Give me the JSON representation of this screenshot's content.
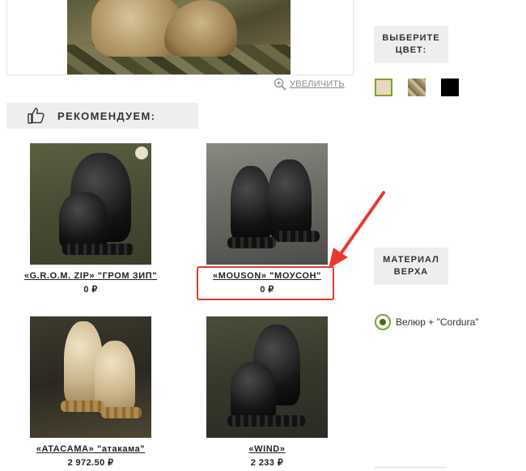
{
  "zoom": {
    "label": "УВЕЛИЧИТЬ",
    "icon": "zoom-in-icon"
  },
  "recommended": {
    "title": "РЕКОМЕНДУЕМ:",
    "icon": "thumbs-up-icon"
  },
  "products": [
    {
      "name": "«G.R.O.M. ZIP» \"ГРОМ ЗИП\"",
      "price": "0 ₽"
    },
    {
      "name": "«MOUSON» \"МОУСОН\"",
      "price": "0 ₽"
    },
    {
      "name": "«ATACAMA» \"атакама\"",
      "price": "2 972.50 ₽"
    },
    {
      "name": "«WIND»",
      "price": "2 233 ₽"
    }
  ],
  "color_picker": {
    "title": "ВЫБЕРИТЕ ЦВЕТ:",
    "swatches": [
      {
        "color": "#ead7bd",
        "selected": true
      },
      {
        "color": "camo",
        "selected": false
      },
      {
        "color": "#000000",
        "selected": false
      }
    ],
    "accent": "#7aa32a"
  },
  "material": {
    "title": "МАТЕРИАЛ ВЕРХА",
    "option": "Велюр + \"Cordura\"",
    "selected": true
  },
  "annotation": {
    "color": "#e8392e"
  }
}
